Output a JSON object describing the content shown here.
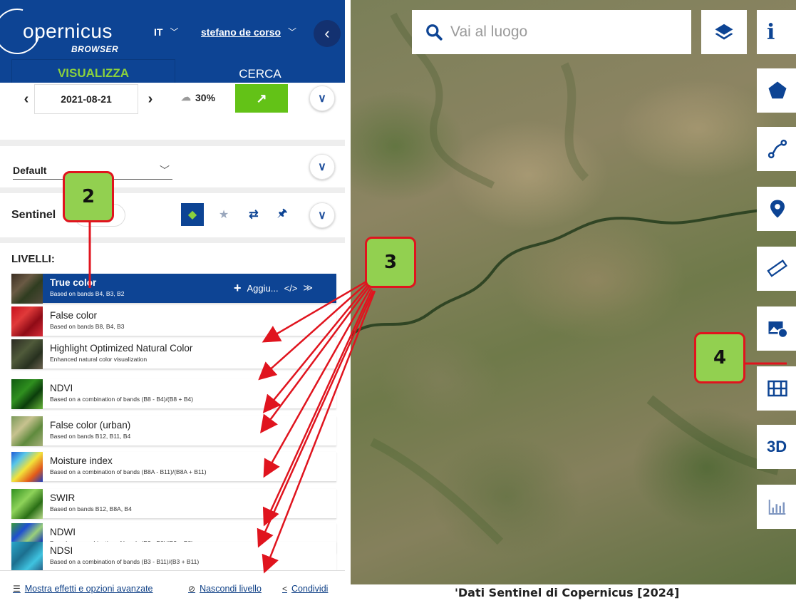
{
  "header": {
    "logo_text": "opernicus",
    "logo_sub": "BROWSER",
    "language": "IT",
    "user": "stefano de corso",
    "collapse_icon": "chevron-left-icon"
  },
  "tabs": [
    {
      "label": "VISUALIZZA",
      "active": true
    },
    {
      "label": "CERCA",
      "active": false
    }
  ],
  "date_bar": {
    "date": "2021-08-21",
    "cloud_cover": "30%",
    "go_icon": "arrow-up-right-icon"
  },
  "theme": {
    "selected": "Default"
  },
  "data_source": {
    "title": "Sentinel",
    "tools": [
      "layers-icon",
      "star-icon",
      "compare-icon",
      "pin-icon"
    ]
  },
  "layers": {
    "heading": "LIVELLI:",
    "actions_label": "Aggiu...",
    "items": [
      {
        "title": "True color",
        "desc": "Based on bands B4, B3, B2",
        "active": true
      },
      {
        "title": "False color",
        "desc": "Based on bands B8, B4, B3",
        "active": false
      },
      {
        "title": "Highlight Optimized Natural Color",
        "desc": "Enhanced natural color visualization",
        "active": false
      },
      {
        "title": "NDVI",
        "desc": "Based on a combination of bands (B8 - B4)/(B8 + B4)",
        "active": false
      },
      {
        "title": "False color (urban)",
        "desc": "Based on bands B12, B11, B4",
        "active": false
      },
      {
        "title": "Moisture index",
        "desc": "Based on a combination of bands (B8A - B11)/(B8A + B11)",
        "active": false
      },
      {
        "title": "SWIR",
        "desc": "Based on bands B12, B8A, B4",
        "active": false
      },
      {
        "title": "NDWI",
        "desc": "Based on a combination of bands (B3 - B8)/(B3 + B8)",
        "active": false
      },
      {
        "title": "NDSI",
        "desc": "Based on a combination of bands (B3 - B11)/(B3 + B11)",
        "active": false
      }
    ]
  },
  "footer": {
    "effects": "Mostra effetti e opzioni avanzate",
    "hide": "Nascondi livello",
    "share": "Condividi"
  },
  "map": {
    "search_placeholder": "Vai al luogo",
    "tools": [
      "info-icon",
      "polygon-icon",
      "distance-icon",
      "poi-icon",
      "ruler-icon",
      "image-download-icon",
      "timelapse-icon",
      "3d-icon",
      "histogram-icon"
    ],
    "tool_3d_label": "3D",
    "tool_info_label": "i",
    "attribution": "'Dati Sentinel di Copernicus [2024]"
  },
  "annotations": {
    "callout_2": "2",
    "callout_3": "3",
    "callout_4": "4",
    "arrow_color": "#e0141e"
  },
  "colors": {
    "brand_blue": "#0d4494",
    "accent_green": "#8bd13d",
    "go_green": "#63c217"
  }
}
